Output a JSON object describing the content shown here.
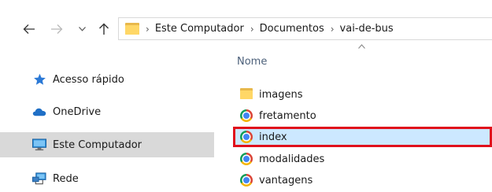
{
  "toolbar": {
    "back_icon": "arrow-left-icon",
    "forward_icon": "arrow-right-icon",
    "recent_icon": "chevron-down-icon",
    "up_icon": "arrow-up-icon"
  },
  "address_bar": {
    "breadcrumbs": [
      "Este Computador",
      "Documentos",
      "vai-de-bus"
    ],
    "separator": "›"
  },
  "sidebar": {
    "items": [
      {
        "label": "Acesso rápido",
        "icon": "star-icon",
        "selected": false
      },
      {
        "label": "OneDrive",
        "icon": "cloud-icon",
        "selected": false
      },
      {
        "label": "Este Computador",
        "icon": "computer-icon",
        "selected": true
      },
      {
        "label": "Rede",
        "icon": "network-icon",
        "selected": false
      }
    ]
  },
  "file_list": {
    "column_header": "Nome",
    "sort_icon": "sort-up-icon",
    "items": [
      {
        "name": "imagens",
        "type": "folder",
        "icon": "folder-icon",
        "highlighted": false
      },
      {
        "name": "fretamento",
        "type": "chrome-html",
        "icon": "chrome-icon",
        "highlighted": false
      },
      {
        "name": "index",
        "type": "chrome-html",
        "icon": "chrome-icon",
        "highlighted": true
      },
      {
        "name": "modalidades",
        "type": "chrome-html",
        "icon": "chrome-icon",
        "highlighted": false
      },
      {
        "name": "vantagens",
        "type": "chrome-html",
        "icon": "chrome-icon",
        "highlighted": false
      }
    ]
  },
  "colors": {
    "selected_nav_bg": "#d9d9d9",
    "highlight_row_bg": "#cce8ff",
    "annotation_red": "#e0101c",
    "header_text": "#4c607a"
  }
}
